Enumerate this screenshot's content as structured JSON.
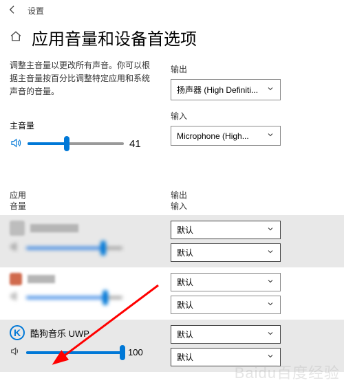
{
  "titlebar": {
    "label": "设置"
  },
  "heading": "应用音量和设备首选项",
  "description": "调整主音量以更改所有声音。你可以根据主音量按百分比调整特定应用和系统声音的音量。",
  "output": {
    "label": "输出",
    "value": "扬声器 (High Definiti..."
  },
  "input": {
    "label": "输入",
    "value": "Microphone (High..."
  },
  "master": {
    "label": "主音量",
    "value": 41
  },
  "apps_header": {
    "left": {
      "line1": "应用",
      "line2": "音量"
    },
    "right": {
      "line1": "输出",
      "line2": "输入"
    }
  },
  "apps": [
    {
      "combo1": "默认",
      "combo2": "默认",
      "vol": 80,
      "blurred": true,
      "shade": true
    },
    {
      "combo1": "默认",
      "combo2": "默认",
      "vol": 82,
      "blurred": true,
      "shade": false,
      "icon2": true
    },
    {
      "name": "酷狗音乐 UWP",
      "combo1": "默认",
      "combo2": "默认",
      "vol": 100,
      "shade": true,
      "kugou": true
    }
  ],
  "watermark": "Baidu百度经验"
}
